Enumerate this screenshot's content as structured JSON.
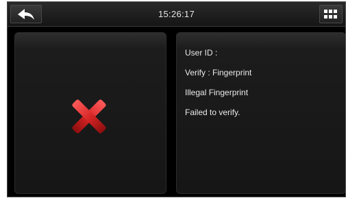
{
  "header": {
    "back_icon": "back-arrow-icon",
    "time": "15:26:17",
    "menu_icon": "grid-menu-icon"
  },
  "result": {
    "icon": "red-x-cross-icon",
    "color": "#cc2020"
  },
  "info": {
    "lines": [
      "User ID :",
      "Verify : Fingerprint",
      "Illegal Fingerprint",
      "Failed to verify."
    ]
  }
}
